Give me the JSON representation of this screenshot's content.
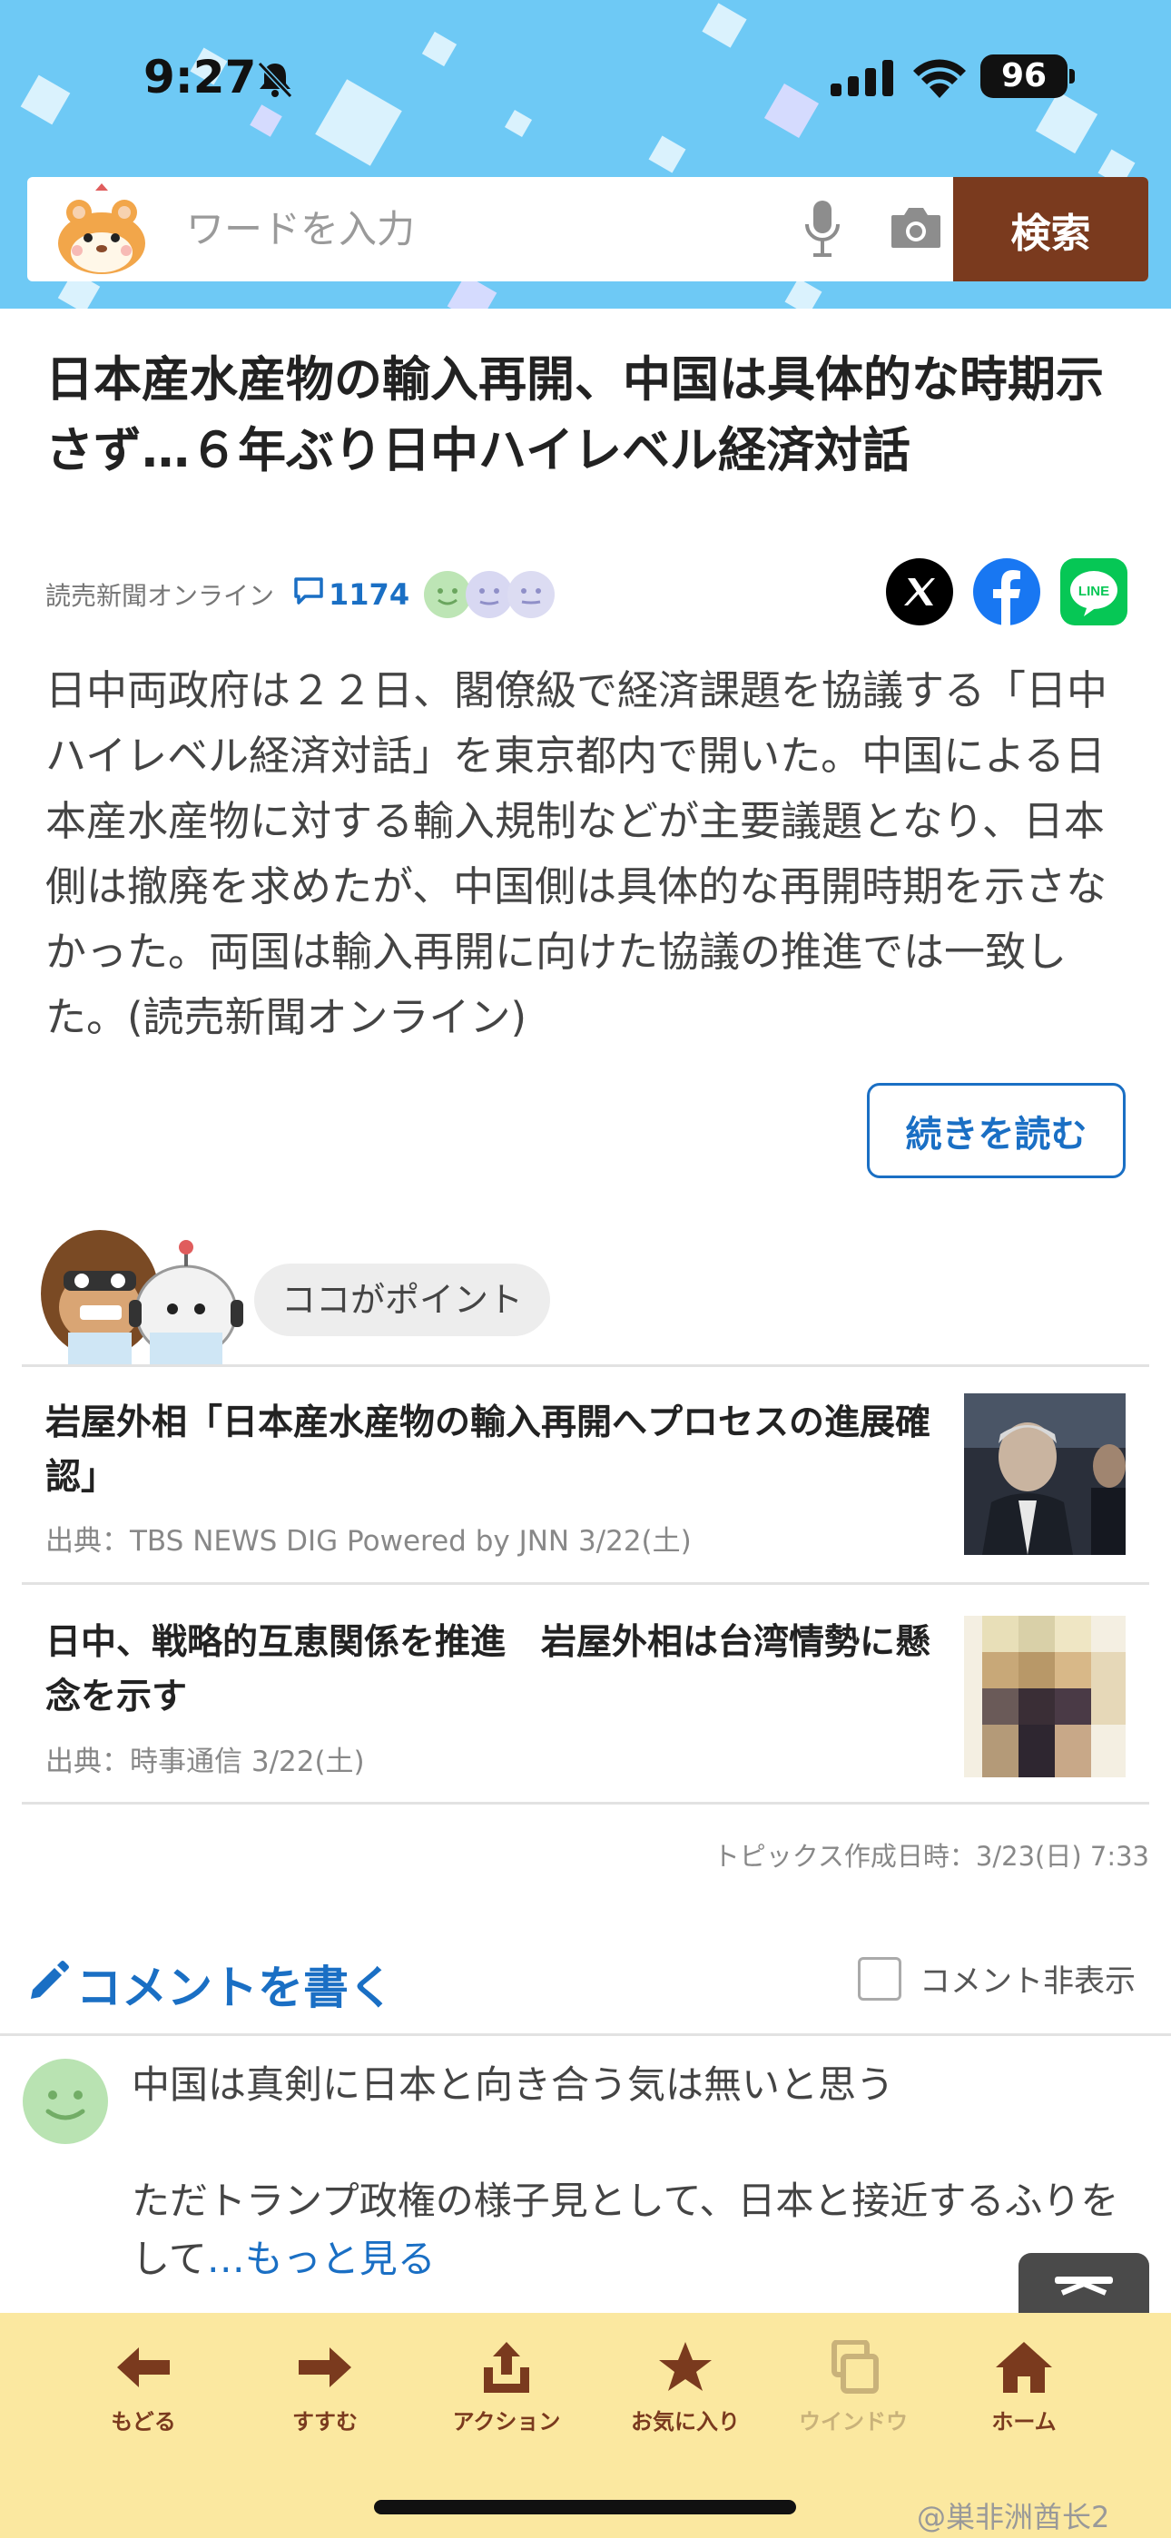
{
  "status_bar": {
    "time": "9:27",
    "battery": "96"
  },
  "search": {
    "placeholder": "ワードを入力",
    "button_label": "検索"
  },
  "article": {
    "title": "日本産水産物の輸入再開、中国は具体的な時期示さず…６年ぶり日中ハイレベル経済対話",
    "source": "読売新聞オンライン",
    "comment_count": "1174",
    "body": "日中両政府は２２日、閣僚級で経済課題を協議する「日中ハイレベル経済対話」を東京都内で開いた。中国による日本産水産物に対する輸入規制などが主要議題となり、日本側は撤廃を求めたが、中国側は具体的な再開時期を示さなかった。両国は輸入再開に向けた協議の推進では一致した。(読売新聞オンライン)",
    "read_more_label": "続きを読む"
  },
  "point": {
    "label": "ココがポイント",
    "items": [
      {
        "title": "岩屋外相「日本産水産物の輸入再開へプロセスの進展確認」",
        "source": "出典：TBS NEWS DIG Powered by JNN 3/22(土)"
      },
      {
        "title": "日中、戦略的互恵関係を推進　岩屋外相は台湾情勢に懸念を示す",
        "source": "出典：時事通信 3/22(土)"
      }
    ],
    "topic_date": "トピックス作成日時：3/23(日) 7:33"
  },
  "comments": {
    "write_label": "コメントを書く",
    "hide_label": "コメント非表示",
    "first": {
      "line1": "中国は真剣に日本と向き合う気は無いと思う",
      "line2": "ただトランプ政権の様子見として、日本と接近するふりをして",
      "more": "…もっと見る"
    }
  },
  "toolbar": {
    "items": [
      {
        "label": "もどる",
        "icon": "arrow-left-icon"
      },
      {
        "label": "すすむ",
        "icon": "arrow-right-icon"
      },
      {
        "label": "アクション",
        "icon": "share-icon"
      },
      {
        "label": "お気に入り",
        "icon": "star-icon"
      },
      {
        "label": "ウインドウ",
        "icon": "windows-icon"
      },
      {
        "label": "ホーム",
        "icon": "home-icon"
      }
    ]
  },
  "watermark": "@巣非洲酋长2",
  "colors": {
    "header": "#6ec9f5",
    "search_button": "#7a3a1e",
    "link": "#1a6fc4",
    "toolbar": "#fbe8a0"
  }
}
